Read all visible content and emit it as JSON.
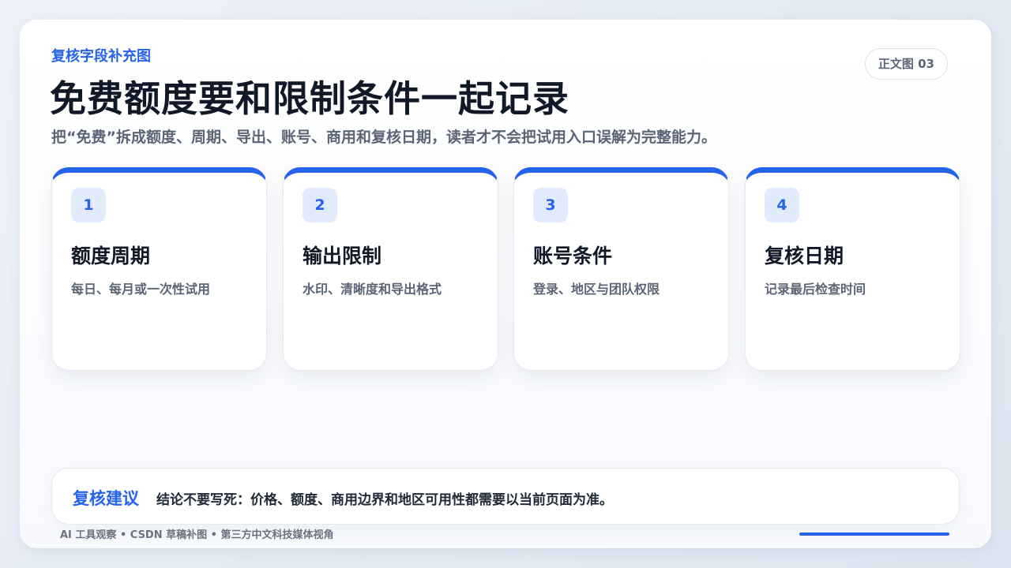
{
  "header": {
    "kicker": "复核字段补充图",
    "page_tag": "正文图 03",
    "title": "免费额度要和限制条件一起记录",
    "subtitle": "把“免费”拆成额度、周期、导出、账号、商用和复核日期，读者才不会把试用入口误解为完整能力。"
  },
  "cards": [
    {
      "num": "1",
      "title": "额度周期",
      "desc": "每日、每月或一次性试用"
    },
    {
      "num": "2",
      "title": "输出限制",
      "desc": "水印、清晰度和导出格式"
    },
    {
      "num": "3",
      "title": "账号条件",
      "desc": "登录、地区与团队权限"
    },
    {
      "num": "4",
      "title": "复核日期",
      "desc": "记录最后检查时间"
    }
  ],
  "note": {
    "label": "复核建议",
    "text": "结论不要写死：价格、额度、商用边界和地区可用性都需要以当前页面为准。"
  },
  "footer": {
    "text": "AI 工具观察 • CSDN 草稿补图 • 第三方中文科技媒体视角"
  },
  "colors": {
    "accent": "#2563eb",
    "title": "#111827",
    "muted": "#5b6577"
  }
}
